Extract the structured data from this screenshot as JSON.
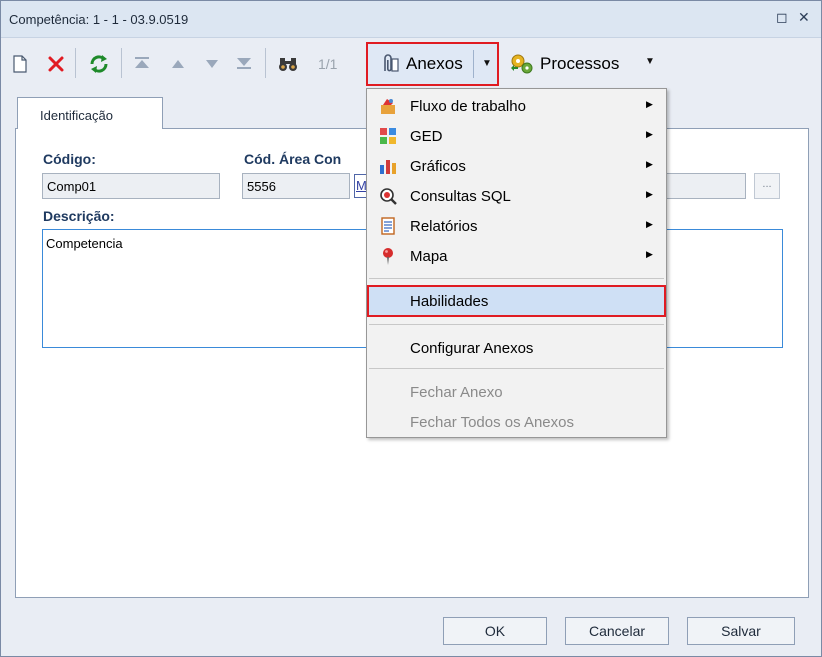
{
  "window": {
    "title": "Competência: 1 - 1 - 03.9.0519",
    "restore_glyph": "◻",
    "close_glyph": "✕"
  },
  "toolbar": {
    "record_counter": "1/1",
    "anexos_label": "Anexos",
    "processos_label": "Processos",
    "icons": [
      "new-icon",
      "delete-icon",
      "refresh-icon",
      "first-icon",
      "previous-icon",
      "next-icon",
      "last-icon",
      "search-binoculars-icon",
      "paperclip-icon",
      "gears-icon"
    ]
  },
  "tabs": [
    {
      "label": "Identificação"
    }
  ],
  "form": {
    "codigo_label": "Código:",
    "codigo_value": "Comp01",
    "area_label": "Cód. Área Con",
    "area_value": "5556",
    "area_link_fragment": "M",
    "lookup_label": "...",
    "descricao_label": "Descrição:",
    "descricao_value": "Competencia"
  },
  "buttons": {
    "ok": "OK",
    "cancelar": "Cancelar",
    "salvar": "Salvar"
  },
  "anexos_menu": {
    "items": [
      {
        "label": "Fluxo de trabalho",
        "icon": "workflow-icon",
        "submenu": true
      },
      {
        "label": "GED",
        "icon": "ged-icon",
        "submenu": true
      },
      {
        "label": "Gráficos",
        "icon": "bar-chart-icon",
        "submenu": true
      },
      {
        "label": "Consultas SQL",
        "icon": "sql-query-icon",
        "submenu": true
      },
      {
        "label": "Relatórios",
        "icon": "report-icon",
        "submenu": true
      },
      {
        "label": "Mapa",
        "icon": "map-pin-icon",
        "submenu": true
      }
    ],
    "highlighted": "Habilidades",
    "configurar": "Configurar Anexos",
    "disabled_items": [
      "Fechar Anexo",
      "Fechar Todos os Anexos"
    ],
    "submenu_arrow": "▶"
  },
  "colors": {
    "highlight_border": "#e01b22",
    "menu_hover": "#cfe0f5",
    "field_focus_border": "#3a8ad9"
  }
}
